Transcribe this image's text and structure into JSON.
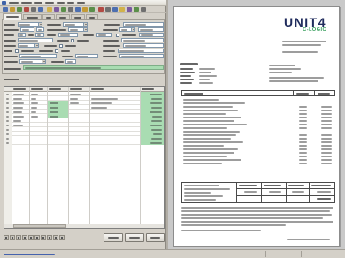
{
  "document": {
    "logo": {
      "brand": "UNIT4",
      "sub": "C-LOGIC"
    }
  },
  "colors": {
    "window_bg": "#d4d0c8",
    "highlight_green": "#a9dcb2",
    "logo_navy": "#1f2b5c",
    "logo_green": "#2e9a55",
    "status_text_blue": "#2b4fa8"
  }
}
